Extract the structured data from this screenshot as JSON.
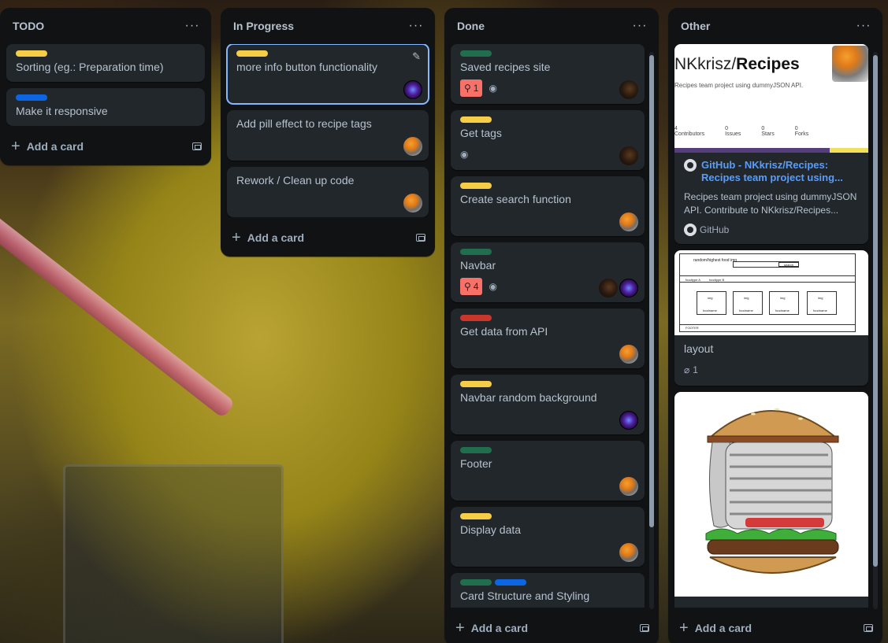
{
  "lists": [
    {
      "title": "TODO",
      "cards": [
        {
          "labels": [
            "#f5cd47"
          ],
          "title": "Sorting (eg.: Preparation time)"
        },
        {
          "labels": [
            "#0c66e4"
          ],
          "title": "Make it responsive"
        }
      ],
      "add_label": "Add a card"
    },
    {
      "title": "In Progress",
      "cards": [
        {
          "labels": [
            "#f5cd47"
          ],
          "title": "more info button functionality",
          "edit_icon": "✎"
        },
        {
          "labels": [],
          "title": "Add pill effect to recipe tags"
        },
        {
          "labels": [],
          "title": "Rework / Clean up code"
        }
      ],
      "add_label": "Add a card"
    },
    {
      "title": "Done",
      "cards": [
        {
          "labels": [
            "#216e4e"
          ],
          "title": "Saved recipes site",
          "badge_count": "1"
        },
        {
          "labels": [
            "#f5cd47"
          ],
          "title": "Get tags"
        },
        {
          "labels": [
            "#f5cd47"
          ],
          "title": "Create search function"
        },
        {
          "labels": [
            "#216e4e"
          ],
          "title": "Navbar",
          "badge_count": "4"
        },
        {
          "labels": [
            "#c9372c"
          ],
          "title": "Get data from API"
        },
        {
          "labels": [
            "#f5cd47"
          ],
          "title": "Navbar random background"
        },
        {
          "labels": [
            "#216e4e"
          ],
          "title": "Footer"
        },
        {
          "labels": [
            "#f5cd47"
          ],
          "title": "Display data"
        },
        {
          "labels": [
            "#216e4e",
            "#0c66e4"
          ],
          "title": "Card Structure and Styling"
        }
      ],
      "add_label": "Add a card"
    },
    {
      "title": "Other",
      "cards": [
        {
          "cover_title_owner": "NKkrisz/",
          "cover_title_repo": "Recipes",
          "cover_subtitle": "Recipes team project using dummyJSON API.",
          "cover_stats": [
            "4",
            "0",
            "0",
            "0"
          ],
          "cover_stat_labels": [
            "Contributors",
            "Issues",
            "Stars",
            "Forks"
          ],
          "link_title": "GitHub - NKkrisz/Recipes: Recipes team project using...",
          "link_desc": "Recipes team project using dummyJSON API. Contribute to NKkrisz/Recipes...",
          "link_source": "GitHub"
        },
        {
          "title": "layout",
          "attachments": "1",
          "wire_header": "random/highest food img",
          "wire_search": "search",
          "wire_types": [
            "foodtype A",
            "foodtype B"
          ],
          "wire_cells": [
            "img",
            "img",
            "img",
            "img"
          ],
          "wire_names": [
            "foodname",
            "foodname",
            "foodname",
            "foodname"
          ],
          "wire_footer": "FOOTER"
        },
        {
          "title": ""
        }
      ],
      "add_label": "Add a card"
    }
  ],
  "icons": {
    "list_menu": "···",
    "plus": "+",
    "eye": "◉",
    "reminder": "⚲",
    "attachment": "⌀"
  }
}
